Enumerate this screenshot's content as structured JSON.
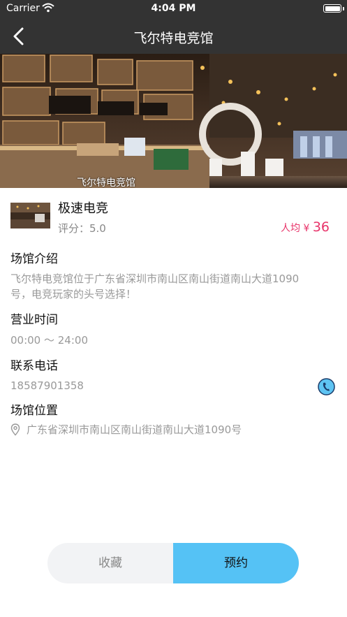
{
  "status_bar": {
    "carrier": "Carrier",
    "time": "4:04 PM"
  },
  "nav": {
    "title": "飞尔特电竞馆"
  },
  "hero": {
    "caption": "飞尔特电竞馆"
  },
  "venue": {
    "name": "极速电竞",
    "rating": "评分：5.0",
    "price_label": "人均 ¥ ",
    "price_value": "36"
  },
  "sections": {
    "intro": {
      "title": "场馆介绍",
      "line1": "飞尔特电竞馆位于广东省深圳市南山区南山街道南山大道1090",
      "line2": "号，电竞玩家的头号选择！"
    },
    "hours": {
      "title": "营业时间",
      "value": "00:00 ～ 24:00"
    },
    "phone": {
      "title": "联系电话",
      "value": "18587901358"
    },
    "location": {
      "title": "场馆位置",
      "value": "广东省深圳市南山区南山街道南山大道1090号"
    }
  },
  "actions": {
    "favorite": "收藏",
    "book": "预约"
  },
  "colors": {
    "accent": "#55c2f5",
    "price": "#e8346a",
    "bar": "#333333"
  }
}
